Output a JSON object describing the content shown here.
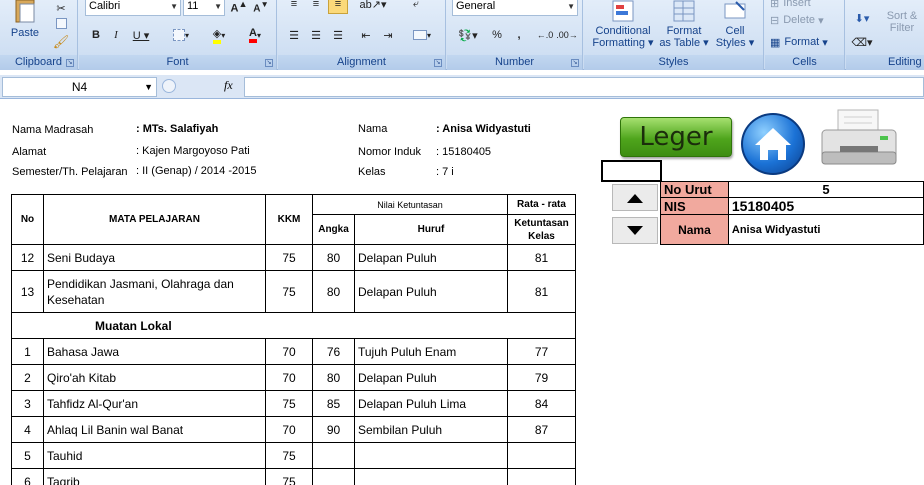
{
  "ribbon": {
    "clipboard": {
      "group_label": "Clipboard",
      "paste_label": "Paste"
    },
    "font": {
      "group_label": "Font",
      "font_name": "Calibri",
      "font_size": "11"
    },
    "alignment": {
      "group_label": "Alignment"
    },
    "number": {
      "group_label": "Number",
      "format": "General"
    },
    "styles": {
      "group_label": "Styles",
      "conditional_formatting": [
        "Conditional",
        "Formatting"
      ],
      "format_as_table": [
        "Format",
        "as Table"
      ],
      "cell_styles": [
        "Cell",
        "Styles"
      ]
    },
    "cells": {
      "group_label": "Cells",
      "insert": "Insert",
      "delete": "Delete",
      "format": "Format"
    },
    "editing": {
      "group_label": "Editing",
      "sort_filter": [
        "Sort &",
        "Filter"
      ]
    }
  },
  "formula_bar": {
    "name_box": "N4",
    "fx": "fx",
    "formula": ""
  },
  "header_info": {
    "madrasah_label": "Nama Madrasah",
    "madrasah_value": ": MTs. Salafiyah",
    "alamat_label": "Alamat",
    "alamat_value": ": Kajen Margoyoso Pati",
    "semester_label": "Semester/Th. Pelajaran",
    "semester_value": ": II (Genap) / 2014 -2015",
    "nama_label": "Nama",
    "nama_value": ": Anisa Widyastuti",
    "nomor_induk_label": "Nomor Induk",
    "nomor_induk_value": ": 15180405",
    "kelas_label": "Kelas",
    "kelas_value": ": 7 i"
  },
  "grades_table": {
    "col_no": "No",
    "col_mapel": "MATA PELAJARAN",
    "col_kkm": "KKM",
    "col_nilai": "Nilai Ketuntasan",
    "col_angka": "Angka",
    "col_huruf": "Huruf",
    "col_rata_1": "Rata - rata",
    "col_rata_2": "Ketuntasan Kelas",
    "rows": [
      {
        "no": "12",
        "mapel": "Seni Budaya",
        "kkm": "75",
        "angka": "80",
        "huruf": "Delapan Puluh",
        "rata": "81"
      },
      {
        "no": "13",
        "mapel": "Pendidikan Jasmani, Olahraga dan Kesehatan",
        "kkm": "75",
        "angka": "80",
        "huruf": "Delapan Puluh",
        "rata": "81"
      }
    ],
    "section_label": "Muatan Lokal",
    "local_rows": [
      {
        "no": "1",
        "mapel": "Bahasa Jawa",
        "kkm": "70",
        "angka": "76",
        "huruf": "Tujuh Puluh Enam",
        "rata": "77"
      },
      {
        "no": "2",
        "mapel": "Qiro'ah Kitab",
        "kkm": "70",
        "angka": "80",
        "huruf": "Delapan Puluh",
        "rata": "79"
      },
      {
        "no": "3",
        "mapel": "Tahfidz Al-Qur'an",
        "kkm": "75",
        "angka": "85",
        "huruf": "Delapan Puluh Lima",
        "rata": "84"
      },
      {
        "no": "4",
        "mapel": "Ahlaq Lil Banin wal Banat",
        "kkm": "70",
        "angka": "90",
        "huruf": "Sembilan Puluh",
        "rata": "87"
      },
      {
        "no": "5",
        "mapel": "Tauhid",
        "kkm": "75",
        "angka": "",
        "huruf": "",
        "rata": ""
      },
      {
        "no": "6",
        "mapel": "Taqrib",
        "kkm": "75",
        "angka": "",
        "huruf": "",
        "rata": ""
      }
    ]
  },
  "buttons": {
    "leger": "Leger"
  },
  "student_panel": {
    "no_urut_label": "No Urut",
    "no_urut_value": "5",
    "nis_label": "NIS",
    "nis_value": "15180405",
    "nama_label": "Nama",
    "nama_value": "Anisa Widyastuti"
  },
  "colors": {
    "label_fill": "#f1a99e",
    "leger_green": "#4fa51c",
    "home_blue": "#1b72d6"
  }
}
